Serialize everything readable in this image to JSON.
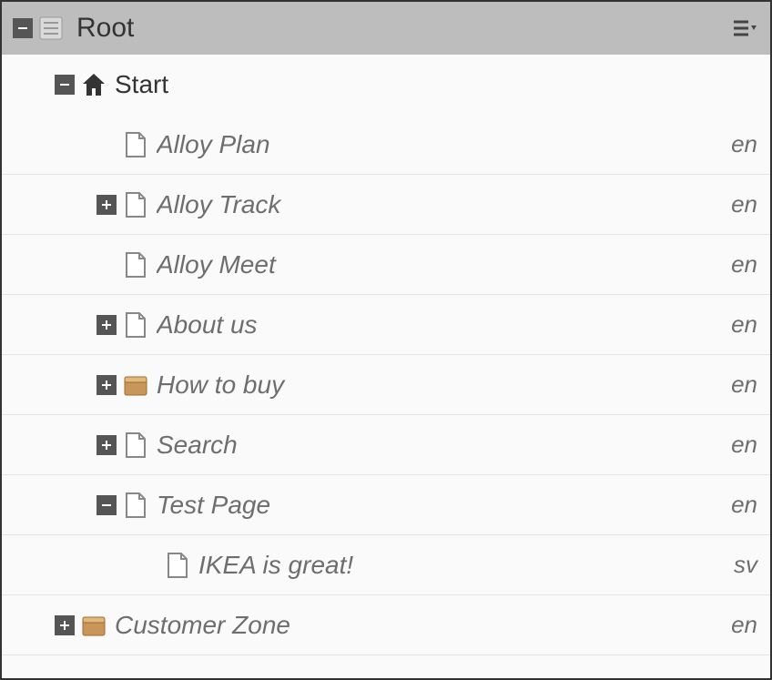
{
  "header": {
    "title": "Root"
  },
  "tree": {
    "start": {
      "label": "Start",
      "lang": ""
    },
    "alloy_plan": {
      "label": "Alloy Plan",
      "lang": "en"
    },
    "alloy_track": {
      "label": "Alloy Track",
      "lang": "en"
    },
    "alloy_meet": {
      "label": "Alloy Meet",
      "lang": "en"
    },
    "about_us": {
      "label": "About us",
      "lang": "en"
    },
    "how_to_buy": {
      "label": "How to buy",
      "lang": "en"
    },
    "search": {
      "label": "Search",
      "lang": "en"
    },
    "test_page": {
      "label": "Test Page",
      "lang": "en"
    },
    "ikea": {
      "label": "IKEA is great!",
      "lang": "sv"
    },
    "customer_zone": {
      "label": "Customer Zone",
      "lang": "en"
    }
  }
}
